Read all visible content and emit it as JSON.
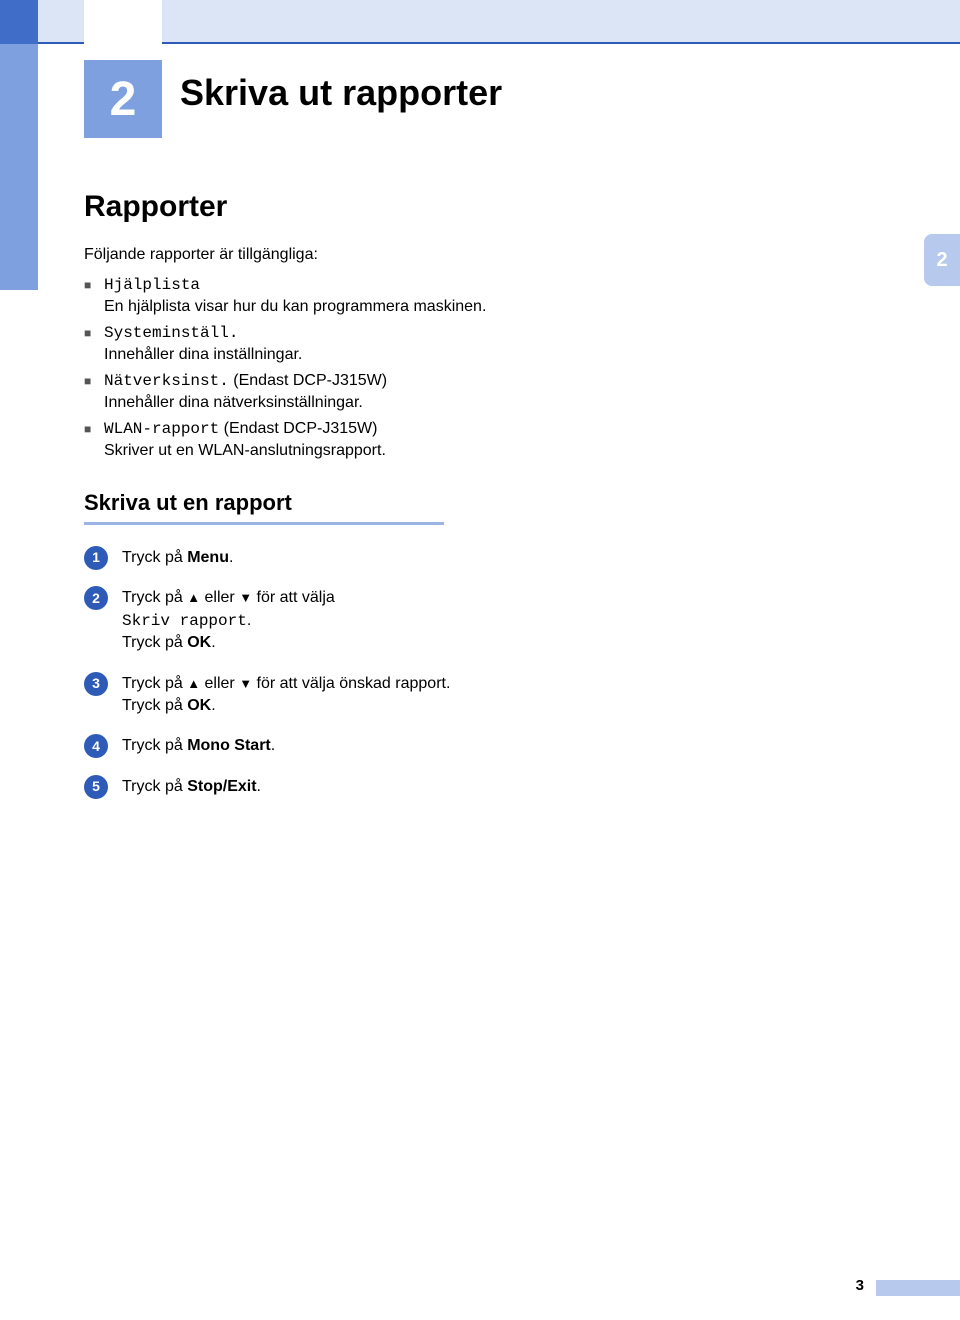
{
  "chapter": {
    "number": "2",
    "title": "Skriva ut rapporter"
  },
  "sideTab": "2",
  "section": {
    "heading": "Rapporter",
    "intro": "Följande rapporter är tillgängliga:",
    "items": [
      {
        "term": "Hjälplista",
        "desc": "En hjälplista visar hur du kan programmera maskinen."
      },
      {
        "term": "Systeminställ.",
        "desc": "Innehåller dina inställningar."
      },
      {
        "term": "Nätverksinst.",
        "termSuffix": " (Endast DCP-J315W)",
        "desc": "Innehåller dina nätverksinställningar."
      },
      {
        "term": "WLAN-rapport",
        "termSuffix": " (Endast DCP-J315W)",
        "desc": "Skriver ut en WLAN-anslutningsrapport."
      }
    ]
  },
  "subsection": {
    "heading": "Skriva ut en rapport",
    "steps": [
      {
        "n": "1",
        "pre": "Tryck på ",
        "bold": "Menu",
        "post": "."
      },
      {
        "n": "2",
        "pre": "Tryck på ",
        "arrows": true,
        "mid": " för att välja",
        "mono": "Skriv rapport",
        "monoPost": ".",
        "line3pre": "Tryck på ",
        "line3bold": "OK",
        "line3post": "."
      },
      {
        "n": "3",
        "pre": "Tryck på ",
        "arrows": true,
        "mid": " för att välja önskad rapport.",
        "line3pre": "Tryck på ",
        "line3bold": "OK",
        "line3post": "."
      },
      {
        "n": "4",
        "pre": "Tryck på ",
        "bold": "Mono Start",
        "post": "."
      },
      {
        "n": "5",
        "pre": "Tryck på ",
        "bold": "Stop/Exit",
        "post": "."
      }
    ]
  },
  "labels": {
    "eller": " eller ",
    "upArrow": "▲",
    "downArrow": "▼"
  },
  "pageNumber": "3"
}
